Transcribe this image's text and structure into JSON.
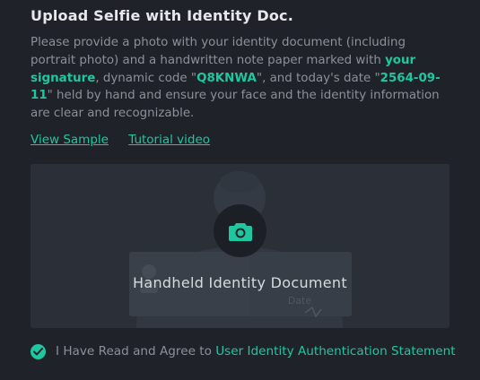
{
  "section": {
    "title": "Upload Selfie with Identity Doc.",
    "desc_part1": "Please provide a photo with your identity document (including portrait photo) and a handwritten note paper marked with ",
    "desc_highlight1": "your signature",
    "desc_part2": ", dynamic code \"",
    "dynamic_code": "Q8KNWA",
    "desc_part3": "\", and today's date \"",
    "date": "2564-09-11",
    "desc_part4": "\" held by hand and ensure your face and the identity information are clear and recognizable."
  },
  "links": {
    "view_sample": "View Sample",
    "tutorial_video": "Tutorial video"
  },
  "upload": {
    "label": "Handheld Identity Document",
    "icon": "camera-icon",
    "sample_note_text": "Date"
  },
  "agreement": {
    "checked": true,
    "text": "I Have Read and Agree to ",
    "link_text": "User Identity Authentication Statement"
  },
  "colors": {
    "accent": "#1fc7a0",
    "background": "#1f2329",
    "upload_area": "#2b3038"
  }
}
